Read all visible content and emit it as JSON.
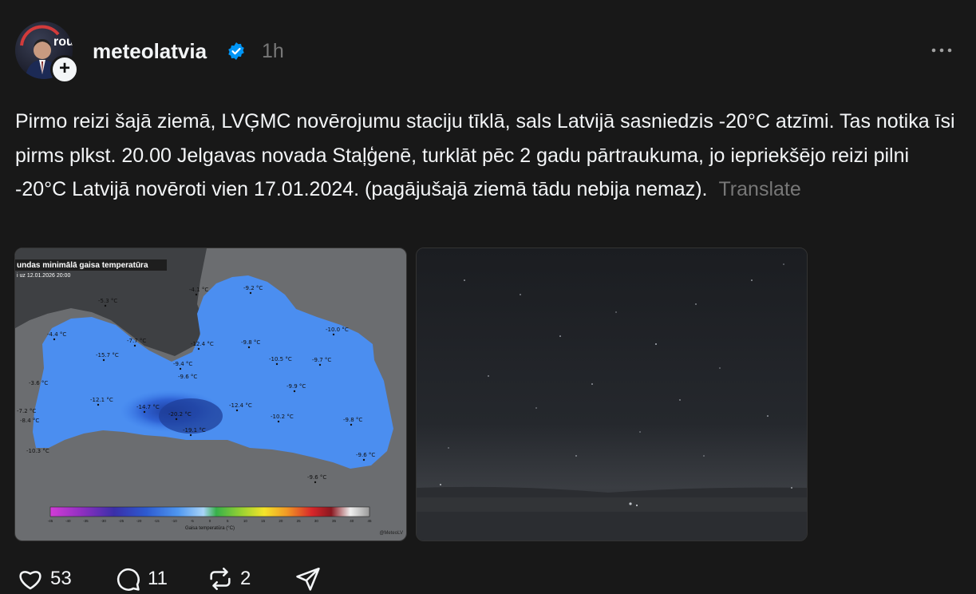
{
  "post": {
    "username": "meteolatvia",
    "timestamp": "1h",
    "text": "Pirmo reizi šajā ziemā, LVĢMC novērojumu staciju tīklā, sals Latvijā sasniedzis -20°C atzīmi. Tas notika īsi pirms plkst. 20.00 Jelgavas novada Staļģenē, turklāt pēc 2 gadu pārtraukuma, jo iepriekšējo reizi pilni -20°C Latvijā novēroti vien 17.01.2024. (pagājušajā ziemā tādu nebija nemaz).",
    "translate_label": "Translate"
  },
  "map": {
    "title": "undas minimālā gaisa temperatūra",
    "subtitle": "i uz 12.01.2026 20:00",
    "legend_label": "Gaisa temperatūra (°C)",
    "legend_ticks": [
      "-45",
      "-40",
      "-35",
      "-30",
      "-25",
      "-20",
      "-15",
      "-10",
      "-5",
      "0",
      "5",
      "10",
      "15",
      "20",
      "25",
      "30",
      "35",
      "40",
      "45"
    ],
    "watermark": "@MeteoLV",
    "stations": [
      {
        "t": "-4.1 °C"
      },
      {
        "t": "-5.3 °C"
      },
      {
        "t": "-9.2 °C"
      },
      {
        "t": "-4.4 °C"
      },
      {
        "t": "-7.7 °C"
      },
      {
        "t": "-12.4 °C"
      },
      {
        "t": "-9.8 °C"
      },
      {
        "t": "-10.0 °C"
      },
      {
        "t": "-15.7 °C"
      },
      {
        "t": "-10.5 °C"
      },
      {
        "t": "-9.7 °C"
      },
      {
        "t": "-9.4 °C"
      },
      {
        "t": "-9.6 °C"
      },
      {
        "t": "-3.6 °C"
      },
      {
        "t": "-9.9 °C"
      },
      {
        "t": "-12.1 °C"
      },
      {
        "t": "-14.7 °C"
      },
      {
        "t": "-20.2 °C"
      },
      {
        "t": "-12.4 °C"
      },
      {
        "t": "-7.2 °C"
      },
      {
        "t": "-10.2 °C"
      },
      {
        "t": "-9.8 °C"
      },
      {
        "t": "-8.4 °C"
      },
      {
        "t": "-19.1 °C"
      },
      {
        "t": "-10.3 °C"
      },
      {
        "t": "-9.6 °C"
      },
      {
        "t": "-9.6 °C"
      }
    ]
  },
  "actions": {
    "likes": "53",
    "comments": "11",
    "reposts": "2"
  },
  "colors": {
    "background": "#181818",
    "text": "#f3f5f7",
    "muted": "#777777",
    "verified": "#0095f6"
  },
  "icons": [
    "plus-icon",
    "verified-badge-icon",
    "more-options-icon",
    "heart-icon",
    "comment-icon",
    "repost-icon",
    "share-icon"
  ]
}
